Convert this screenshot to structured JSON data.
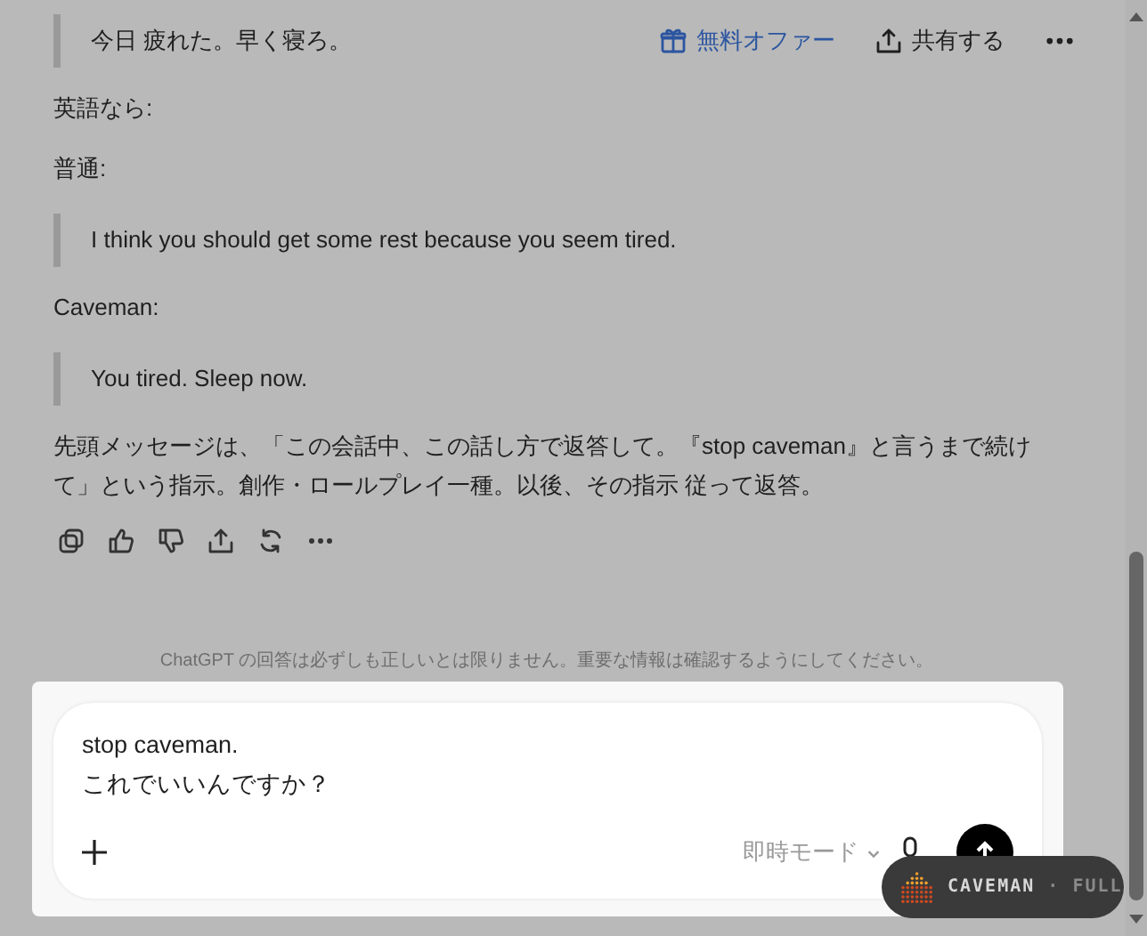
{
  "header": {
    "actions": [
      {
        "kind": "offer",
        "label": "無料オファー"
      },
      {
        "kind": "share",
        "label": "共有する"
      },
      {
        "kind": "more"
      }
    ]
  },
  "message": {
    "blocks": [
      {
        "kind": "quote",
        "text": "今日 疲れた。早く寝ろ。"
      },
      {
        "kind": "text",
        "text": "英語なら:"
      },
      {
        "kind": "text",
        "text": "普通:"
      },
      {
        "kind": "quote",
        "text": "I think you should get some rest because you seem tired."
      },
      {
        "kind": "text",
        "text": "Caveman:"
      },
      {
        "kind": "quote",
        "text": "You tired. Sleep now."
      },
      {
        "kind": "text",
        "text": "先頭メッセージは、「この会話中、この話し方で返答して。『stop caveman』と言うまで続けて」という指示。創作・ロールプレイ一種。以後、その指示 従って返答。"
      }
    ]
  },
  "message_actions": [
    {
      "kind": "copy"
    },
    {
      "kind": "like"
    },
    {
      "kind": "dislike"
    },
    {
      "kind": "share"
    },
    {
      "kind": "regenerate"
    },
    {
      "kind": "more"
    }
  ],
  "disclaimer": "ChatGPT の回答は必ずしも正しいとは限りません。重要な情報は確認するようにしてください。",
  "composer": {
    "lines": [
      "stop caveman.",
      "これでいいんですか？"
    ],
    "mode": "即時モード"
  },
  "badge": {
    "name": "CAVEMAN",
    "separator": "·",
    "level_text": "FULL"
  }
}
